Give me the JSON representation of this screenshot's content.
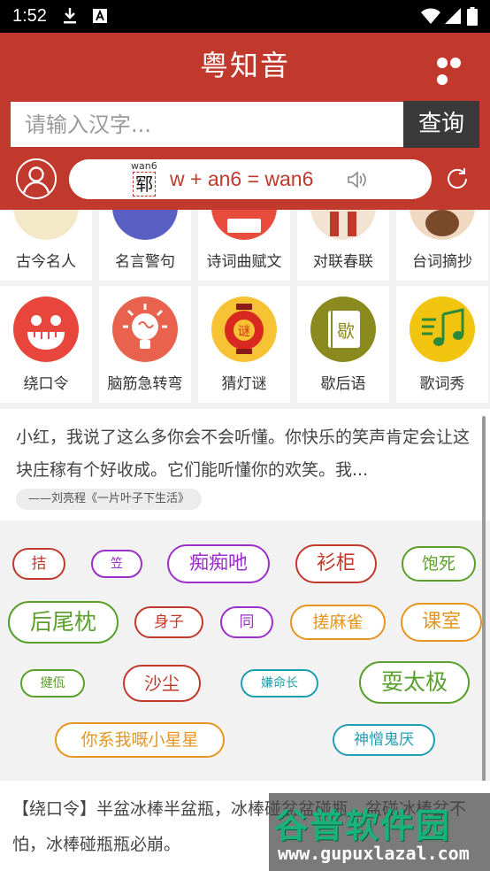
{
  "status_bar": {
    "time": "1:52"
  },
  "app": {
    "title": "粤知音"
  },
  "search": {
    "placeholder": "请输入汉字...",
    "button_label": "查询"
  },
  "pronunciation": {
    "pinyin_small": "wan6",
    "char": "郓",
    "formula": "w + an6 = wan6"
  },
  "categories_row1": [
    {
      "label": "古今名人",
      "color": "#e8d9b0"
    },
    {
      "label": "名言警句",
      "color": "#5a5fc4"
    },
    {
      "label": "诗词曲赋文",
      "color": "#e74c3c"
    },
    {
      "label": "对联春联",
      "color": "#c0392b"
    },
    {
      "label": "台词摘抄",
      "color": "#7a4a2b"
    }
  ],
  "categories_row2": [
    {
      "label": "绕口令",
      "color": "#e8453c",
      "icon": "laughing-face-icon"
    },
    {
      "label": "脑筋急转弯",
      "color": "#e8624d",
      "icon": "lightbulb-brain-icon"
    },
    {
      "label": "猜灯谜",
      "color": "#f7c234",
      "icon": "lantern-icon"
    },
    {
      "label": "歇后语",
      "color": "#8a8a1e",
      "icon": "book-icon"
    },
    {
      "label": "歌词秀",
      "color": "#f1c40f",
      "icon": "music-note-icon"
    }
  ],
  "quote": {
    "text": "小红，我说了这么多你会不会听懂。你快乐的笑声肯定会让这块庄稼有个好收成。它们能听懂你的欢笑。我...",
    "source": "——刘亮程《一片叶子下生活》"
  },
  "tags": [
    {
      "text": "拮",
      "color": "#c0392b"
    },
    {
      "text": "笠",
      "color": "#9b30c8"
    },
    {
      "text": "痴痴吔",
      "color": "#9b30c8"
    },
    {
      "text": "衫柜",
      "color": "#c0392b"
    },
    {
      "text": "饱死",
      "color": "#5aa02c"
    },
    {
      "text": "后尾枕",
      "color": "#5aa02c"
    },
    {
      "text": "身子",
      "color": "#c0392b"
    },
    {
      "text": "同",
      "color": "#9b30c8"
    },
    {
      "text": "搓麻雀",
      "color": "#e69520"
    },
    {
      "text": "课室",
      "color": "#e69520"
    },
    {
      "text": "揵佤",
      "color": "#5aa02c"
    },
    {
      "text": "沙尘",
      "color": "#c0392b"
    },
    {
      "text": "嫌命长",
      "color": "#1f9fb0"
    },
    {
      "text": "耍太极",
      "color": "#5aa02c"
    },
    {
      "text": "你系我嘅小星星",
      "color": "#e69520"
    },
    {
      "text": "神憎鬼厌",
      "color": "#1f9fb0"
    }
  ],
  "bottom": {
    "text": "【绕口令】半盆冰棒半盆瓶，冰棒碰盆盆碰瓶，盆碰冰棒盆不怕，冰棒碰瓶瓶必崩。"
  },
  "watermark": {
    "cn": "谷普软件园",
    "url": "www.gupuxlazal.com"
  },
  "colors": {
    "primary": "#c1382d",
    "search_button": "#3a3a3a"
  }
}
